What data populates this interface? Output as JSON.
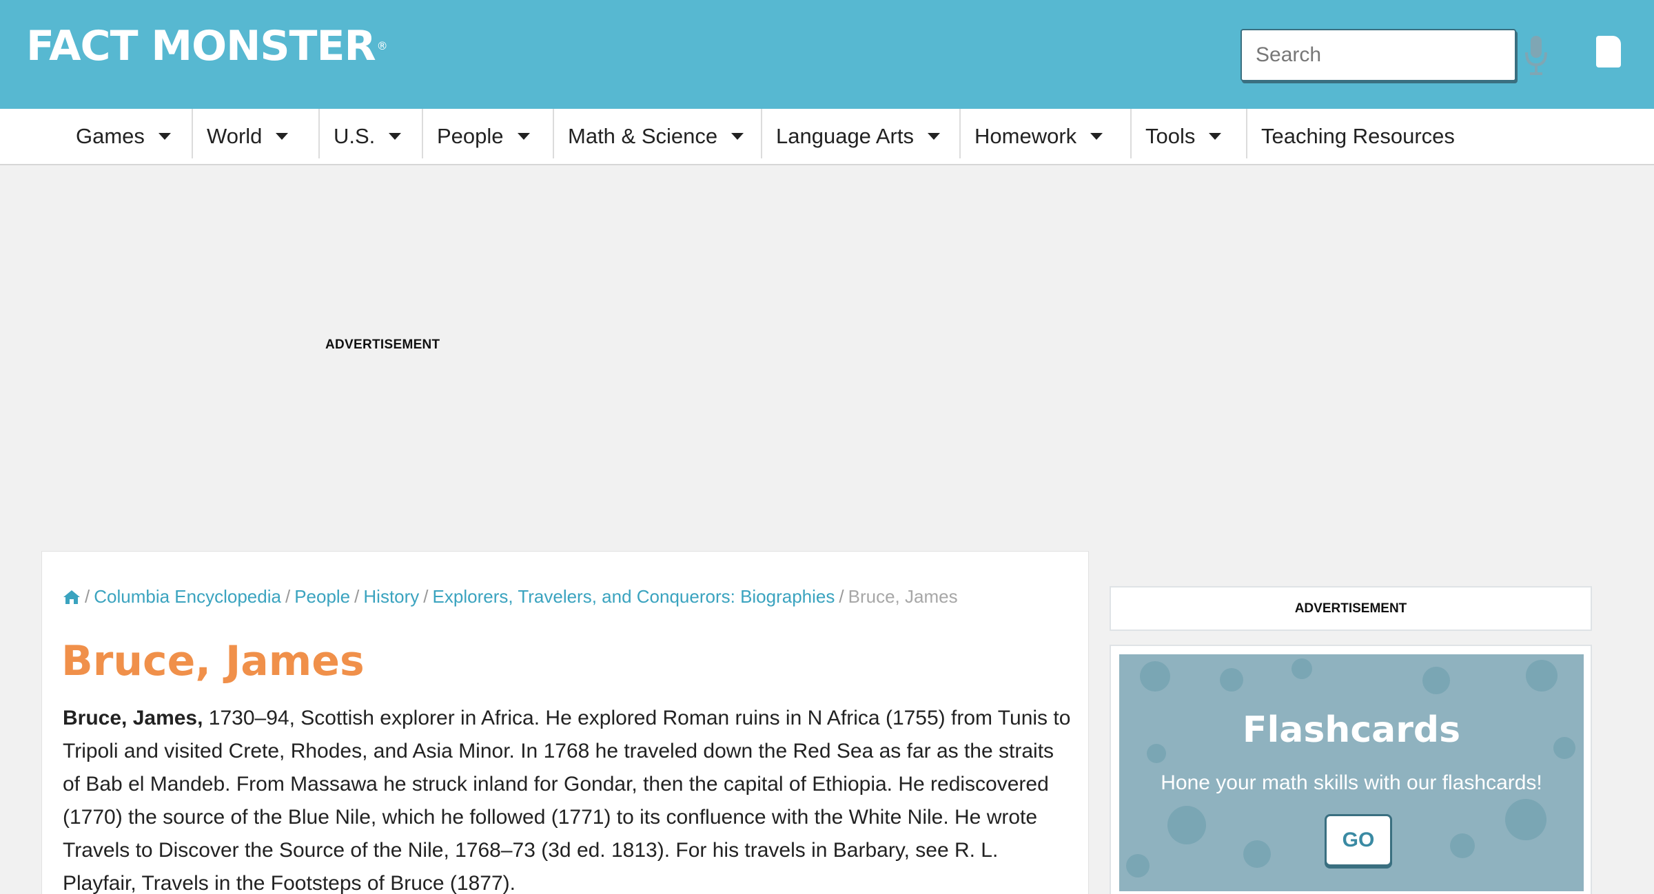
{
  "header": {
    "logo_text": "FACT MONSTER",
    "logo_mark": "®",
    "search_placeholder": "Search"
  },
  "icons": {
    "mic": "microphone-icon",
    "user": "user-icon",
    "home": "home-icon",
    "caret": "caret-down-icon"
  },
  "nav": {
    "items": [
      {
        "label": "Games"
      },
      {
        "label": "World"
      },
      {
        "label": "U.S."
      },
      {
        "label": "People"
      },
      {
        "label": "Math & Science"
      },
      {
        "label": "Language Arts"
      },
      {
        "label": "Homework"
      },
      {
        "label": "Tools"
      },
      {
        "label": "Teaching Resources"
      }
    ]
  },
  "top_ad": {
    "label": "ADVERTISEMENT"
  },
  "breadcrumb": {
    "items": [
      {
        "label": "Columbia Encyclopedia"
      },
      {
        "label": "People"
      },
      {
        "label": "History"
      },
      {
        "label": "Explorers, Travelers, and Conquerors: Biographies"
      }
    ],
    "separator": "/",
    "current": "Bruce, James"
  },
  "article": {
    "title": "Bruce, James",
    "lead": "Bruce, James,",
    "body": " 1730–94, Scottish explorer in Africa. He explored Roman ruins in N Africa (1755) from Tunis to Tripoli and visited Crete, Rhodes, and Asia Minor. In 1768 he traveled down the Red Sea as far as the straits of Bab el Mandeb. From Massawa he struck inland for Gondar, then the capital of Ethiopia. He rediscovered (1770) the source of the Blue Nile, which he followed (1771) to its confluence with the White Nile. He wrote Travels to Discover the Source of the Nile, 1768–73 (3d ed. 1813). For his travels in Barbary, see R. L. Playfair, Travels in the Footsteps of Bruce (1877)."
  },
  "sidebar": {
    "ad_label": "ADVERTISEMENT",
    "promo": {
      "title": "Flashcards",
      "subtitle": "Hone your math skills with our flashcards!",
      "button": "GO"
    }
  },
  "colors": {
    "header_bg": "#57b8d1",
    "title_orange": "#f0904a",
    "link_blue": "#3aa3bf",
    "promo_bg": "#8fb2bf"
  }
}
